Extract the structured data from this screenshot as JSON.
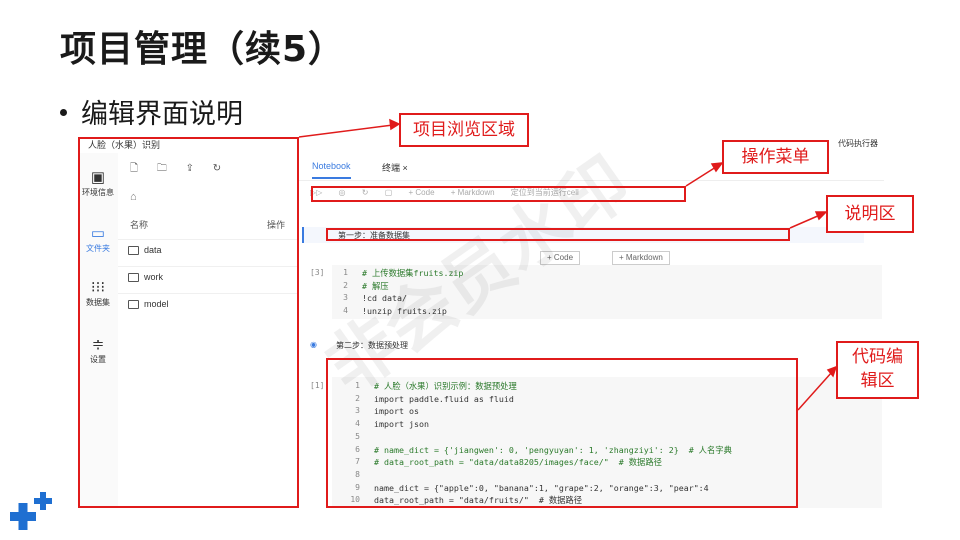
{
  "slide": {
    "title": "项目管理（续5）",
    "bullet": "编辑界面说明"
  },
  "watermark": "非会员水印",
  "annotations": {
    "browse_area": "项目浏览区域",
    "operation_menu": "操作菜单",
    "description_area": "说明区",
    "code_area_line1": "代码编",
    "code_area_line2": "辑区"
  },
  "app": {
    "project_name": "人脸（水果）识别",
    "code_executor": "代码执行器",
    "nav": [
      {
        "label": "环境信息",
        "icon": "grid-icon"
      },
      {
        "label": "文件夹",
        "icon": "folder-icon"
      },
      {
        "label": "数据集",
        "icon": "dots-grid-icon"
      },
      {
        "label": "设置",
        "icon": "sliders-icon"
      }
    ],
    "files": {
      "col_name": "名称",
      "col_op": "操作",
      "items": [
        "data",
        "work",
        "model"
      ]
    },
    "tabs": [
      "Notebook",
      "终端"
    ],
    "tab_close": "×",
    "toolbar": {
      "add_code": "+ Code",
      "add_markdown": "+ Markdown",
      "locate": "定位到当前运行cell"
    },
    "cell_md1": "第一步：准备数据集",
    "add_code_btn": "+ Code",
    "add_md_btn": "+ Markdown",
    "exec1": "[3]",
    "code1": [
      "# 上传数据集fruits.zip",
      "# 解压",
      "!cd data/",
      "!unzip fruits.zip"
    ],
    "cell_md2": "第二步：数据预处理",
    "exec2": "[1]",
    "code2": [
      "# 人脸（水果）识别示例：数据预处理",
      "import paddle.fluid as fluid",
      "import os",
      "import json",
      "",
      "# name_dict = {'jiangwen': 0, 'pengyuyan': 1, 'zhangziyi': 2}  # 人名字典",
      "# data_root_path = \"data/data8205/images/face/\"  # 数据路径",
      "",
      "name_dict = {\"apple\":0, \"banana\":1, \"grape\":2, \"orange\":3, \"pear\":4",
      "data_root_path = \"data/fruits/\"  # 数据路径"
    ]
  },
  "colors": {
    "annotation_red": "#e01b1b",
    "accent_blue": "#3a7be0",
    "logo_blue": "#1f6fd1"
  }
}
